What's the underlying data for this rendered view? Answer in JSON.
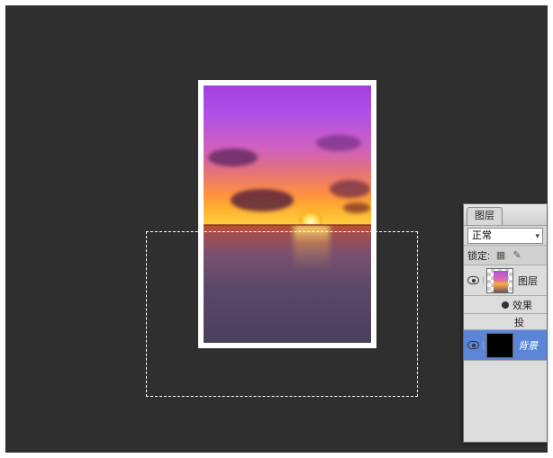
{
  "panel": {
    "tab_label": "图层",
    "blend_mode": "正常",
    "lock_label": "锁定:",
    "layers": [
      {
        "label": "图层",
        "eye": true,
        "thumb": "sunset"
      },
      {
        "label": "效果",
        "sub": true,
        "fx": true
      },
      {
        "label": "投",
        "sub2": true
      },
      {
        "label": "背景",
        "eye": true,
        "thumb": "black",
        "active": true
      }
    ]
  }
}
